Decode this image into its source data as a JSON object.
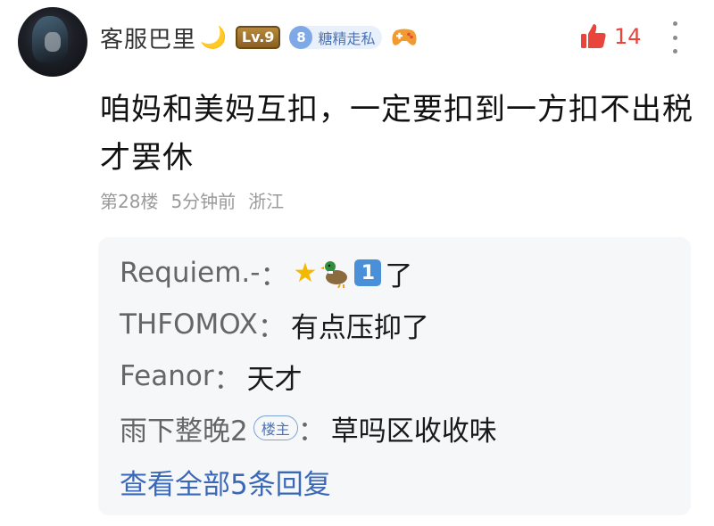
{
  "comment": {
    "username": "客服巴里",
    "level_badge": "Lv.9",
    "fan_badge": {
      "level": "8",
      "name": "糖精走私"
    },
    "like_count": "14",
    "text": "咱妈和美妈互扣，一定要扣到一方扣不出税才罢休",
    "floor": "第28楼",
    "time": "5分钟前",
    "location": "浙江",
    "icons": {
      "avatar": "user-avatar",
      "moon": "crescent-moon-emoji",
      "gamepad": "gamepad-icon",
      "like": "thumbs-up-icon",
      "more": "more-vertical-icon"
    },
    "colors": {
      "like": "#e8453c",
      "link": "#3a68b8",
      "fan_badge_bg": "#e8f0fb"
    }
  },
  "replies": [
    {
      "author": "Requiem.-",
      "colon": "：",
      "text": "了",
      "emojis": [
        "star-emoji",
        "duck-emoji",
        "keycap-one-emoji"
      ],
      "emoji_one": "1"
    },
    {
      "author": "THFOMOX",
      "colon": "：",
      "text": "有点压抑了"
    },
    {
      "author": "Feanor",
      "colon": "：",
      "text": "天才"
    },
    {
      "author": "雨下整晚2",
      "colon": "：",
      "text": "草吗区收收味",
      "badge": "楼主"
    }
  ],
  "view_all": "查看全部5条回复"
}
